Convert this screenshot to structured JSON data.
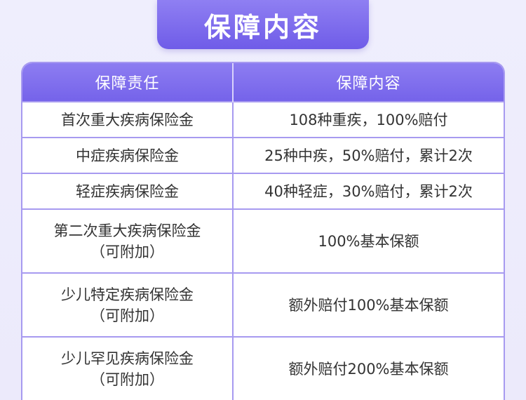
{
  "title": "保障内容",
  "table": {
    "headers": [
      "保障责任",
      "保障内容"
    ],
    "rows": [
      {
        "duty": "首次重大疾病保险金",
        "duty_note": "",
        "content": "108种重疾，100%赔付"
      },
      {
        "duty": "中症疾病保险金",
        "duty_note": "",
        "content": "25种中疾，50%赔付，累计2次"
      },
      {
        "duty": "轻症疾病保险金",
        "duty_note": "",
        "content": "40种轻症，30%赔付，累计2次"
      },
      {
        "duty": "第二次重大疾病保险金",
        "duty_note": "（可附加）",
        "content": "100%基本保额"
      },
      {
        "duty": "少儿特定疾病保险金",
        "duty_note": "（可附加）",
        "content": "额外赔付100%基本保额"
      },
      {
        "duty": "少儿罕见疾病保险金",
        "duty_note": "（可附加）",
        "content": "额外赔付200%基本保额"
      }
    ]
  },
  "colors": {
    "accent": "#7563ea",
    "border": "#a79af0",
    "background": "#eceafb"
  }
}
